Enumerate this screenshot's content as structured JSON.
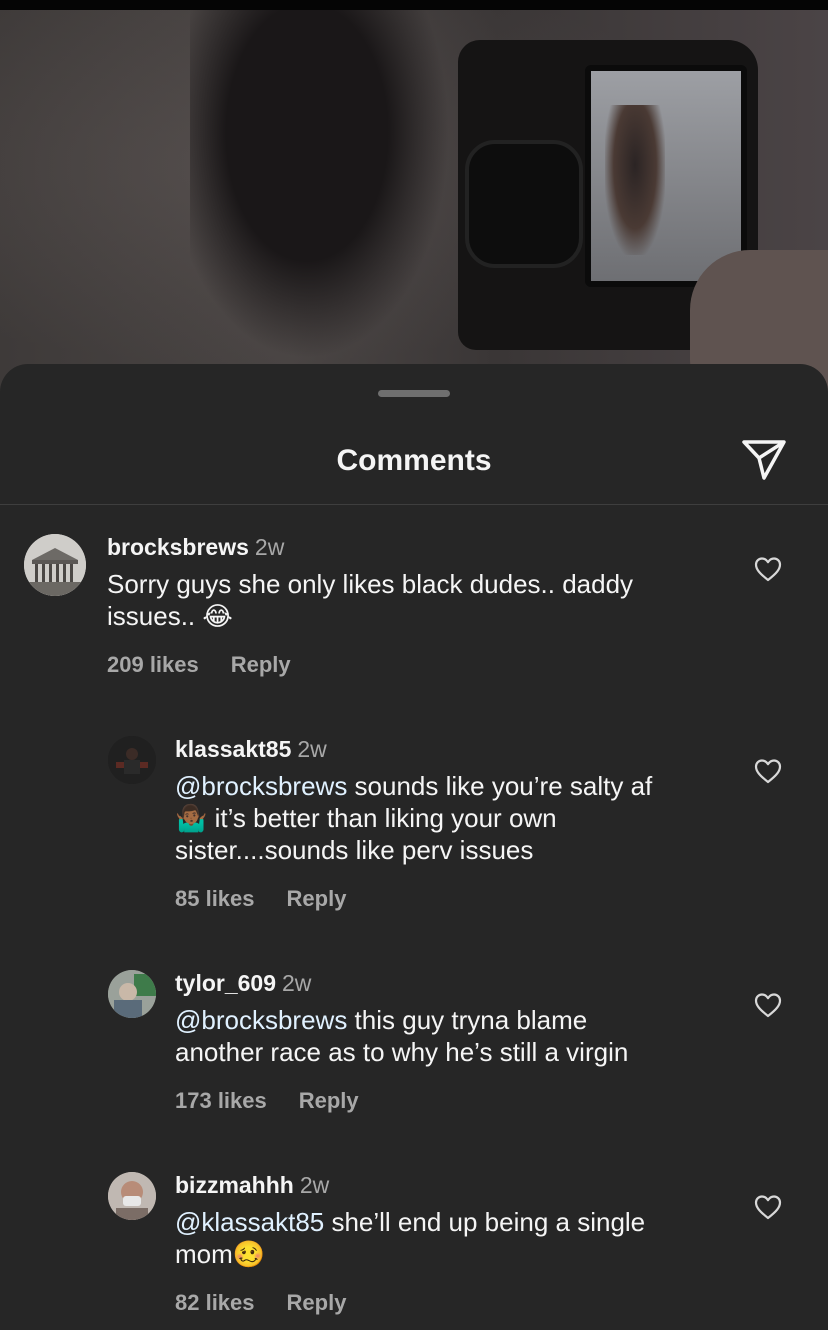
{
  "sheet": {
    "title": "Comments"
  },
  "comments": [
    {
      "user": "brocksbrews",
      "time": "2w",
      "mention": "",
      "text_line1": "Sorry guys she only likes black dudes.. daddy",
      "text_line2": "issues.. ",
      "emoji": "😂",
      "likes": "209 likes",
      "reply": "Reply",
      "avatar_icon": "building-avatar"
    },
    {
      "user": "klassakt85",
      "time": "2w",
      "mention": "@brocksbrews",
      "text_line1": " sounds like you’re salty af",
      "emoji": "🤷🏾‍♂️",
      "text_line2": " it’s better than liking your own",
      "text_line3": "sister....sounds like perv issues",
      "likes": "85 likes",
      "reply": "Reply",
      "avatar_icon": "person-avatar"
    },
    {
      "user": "tylor_609",
      "time": "2w",
      "mention": "@brocksbrews",
      "text_line1": " this guy tryna blame",
      "text_line2": "another race as to why he’s still a virgin",
      "likes": "173 likes",
      "reply": "Reply",
      "avatar_icon": "person-avatar"
    },
    {
      "user": "bizzmahhh",
      "time": "2w",
      "mention": "@klassakt85",
      "text_line1": " she’ll end up being a single",
      "text_line2": "mom",
      "emoji": "🥴",
      "likes": "82 likes",
      "reply": "Reply",
      "avatar_icon": "person-avatar"
    }
  ],
  "colors": {
    "sheet_bg": "#262626",
    "secondary_text": "#a8a8a8",
    "mention": "#e0f1ff"
  }
}
